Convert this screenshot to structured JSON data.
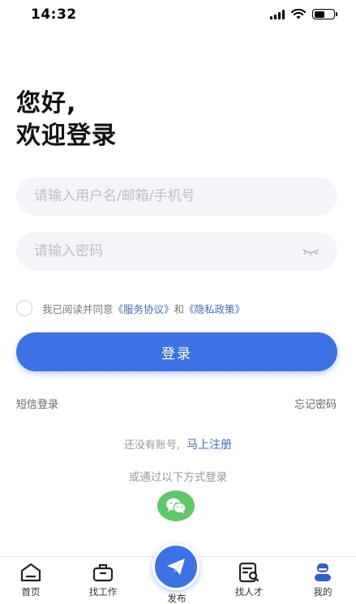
{
  "status_bar": {
    "time": "14:32"
  },
  "greeting": {
    "line1": "您好,",
    "line2": "欢迎登录"
  },
  "form": {
    "username_placeholder": "请输入用户名/邮箱/手机号",
    "username_value": "",
    "password_placeholder": "请输入密码",
    "password_value": ""
  },
  "agreement": {
    "prefix": "我已阅读并同意",
    "service_link": "《服务协议》",
    "and": "和",
    "privacy_link": "《隐私政策》",
    "checked": false
  },
  "login_button": "登录",
  "links": {
    "sms_login": "短信登录",
    "forgot_password": "忘记密码"
  },
  "register": {
    "prompt": "还没有账号,",
    "link": "马上注册"
  },
  "other_login": "或通过以下方式登录",
  "tabs": [
    {
      "label": "首页",
      "icon": "home-icon"
    },
    {
      "label": "找工作",
      "icon": "briefcase-icon"
    },
    {
      "label": "发布",
      "icon": "paper-plane-icon"
    },
    {
      "label": "找人才",
      "icon": "resume-search-icon"
    },
    {
      "label": "我的",
      "icon": "user-icon"
    }
  ],
  "colors": {
    "primary": "#3d72e6",
    "link": "#3f6bd8",
    "wechat": "#5ec866",
    "field_bg": "#f4f5f8"
  }
}
